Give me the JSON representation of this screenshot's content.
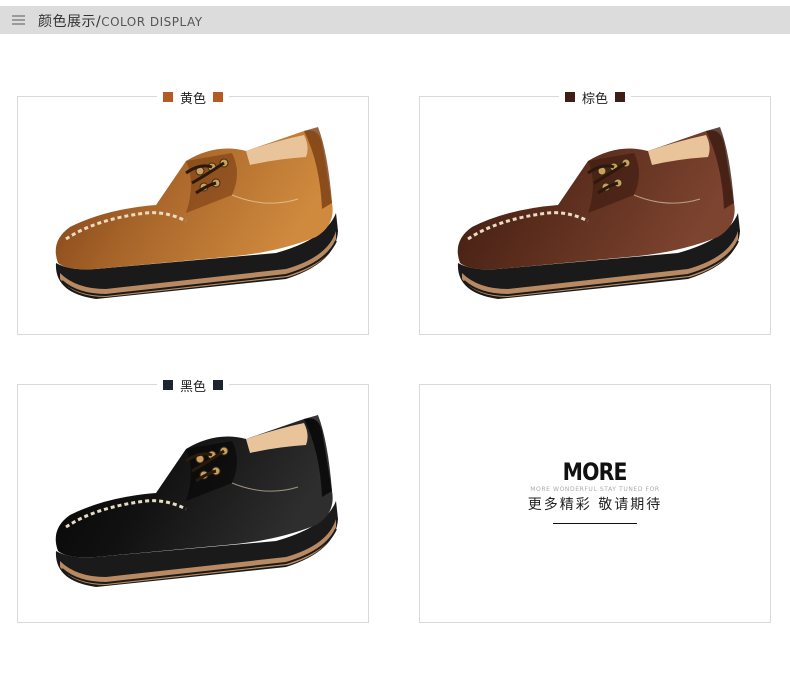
{
  "header": {
    "title_cn": "颜色展示/",
    "title_en": "COLOR DISPLAY",
    "icon": "menu-icon"
  },
  "products": [
    {
      "label": "黄色",
      "swatch_color": "#b55a24",
      "upper": "#a8652a",
      "upper_light": "#d08a3e",
      "toe": "#7a3d14"
    },
    {
      "label": "棕色",
      "swatch_color": "#3d1f16",
      "upper": "#5a2c1c",
      "upper_light": "#7d4430",
      "toe": "#3b1a10"
    },
    {
      "label": "黑色",
      "swatch_color": "#1e2430",
      "upper": "#111111",
      "upper_light": "#2e2e2e",
      "toe": "#050505"
    }
  ],
  "more": {
    "title": "MORE",
    "subtitle": "MORE WONDERFUL STAY TUNED FOR",
    "cn_text": "更多精彩 敬请期待"
  }
}
